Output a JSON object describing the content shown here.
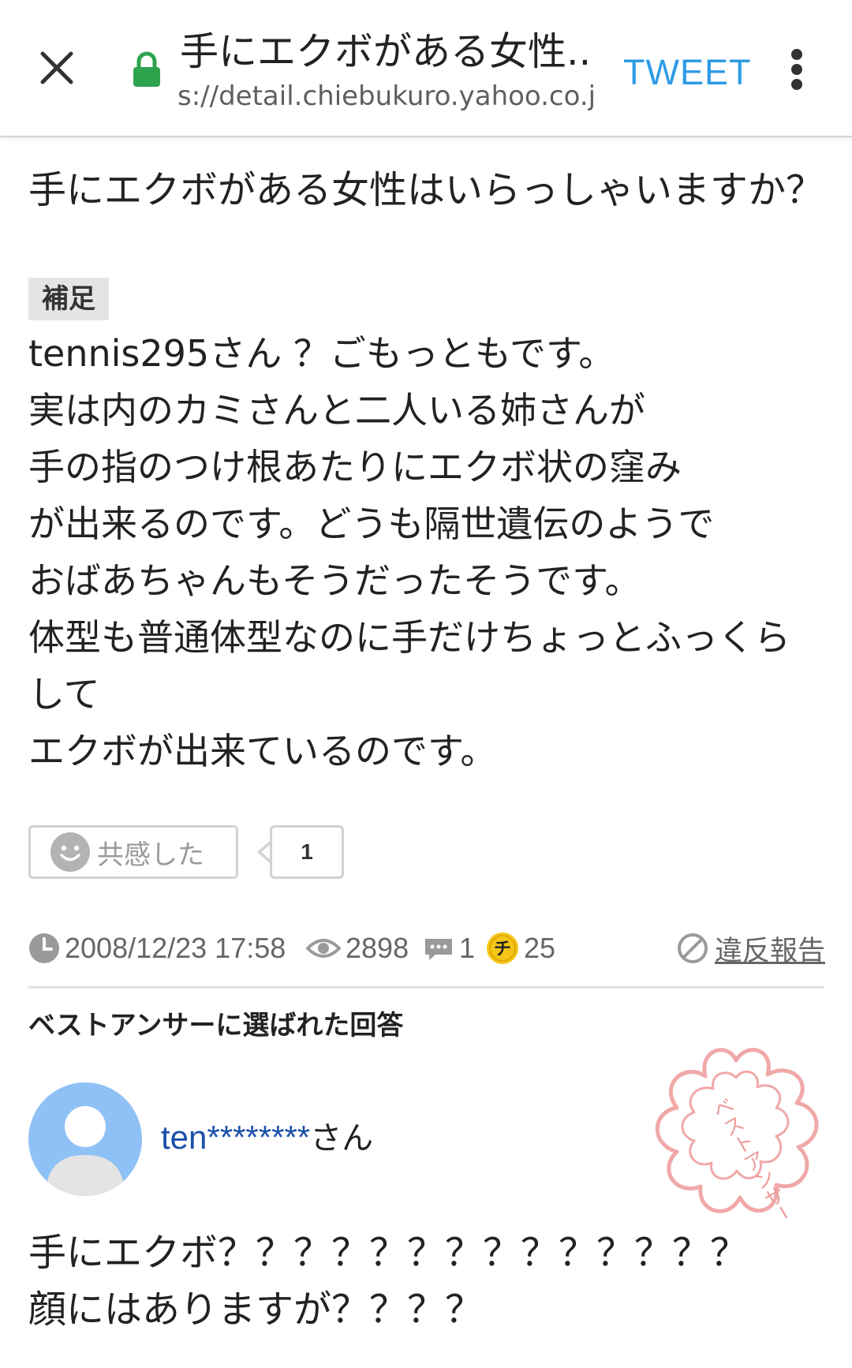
{
  "browser": {
    "title": "手にエクボがある女性...",
    "url": "s://detail.chiebukuro.yahoo.co.jp",
    "tweet_label": "TWEET",
    "close_icon": "close-icon",
    "lock_icon": "lock-icon",
    "menu_icon": "more-vert-icon",
    "colors": {
      "tweet": "#2e9be6",
      "lock": "#2ea44f"
    }
  },
  "question": {
    "title": "手にエクボがある女性はいらっしゃいますか？",
    "supplement_label": "補足",
    "body_lines": [
      "tennis295さん ？ごもっともです。",
      "実は内のカミさんと二人いる姉さんが",
      "手の指のつけ根あたりにエクボ状の窪み",
      "が出来るのです。どうも隔世遺伝のようで",
      "おばあちゃんもそうだったそうです。",
      "体型も普通体型なのに手だけちょっとふっくら",
      "して",
      "エクボが出来ているのです。"
    ],
    "empathy_label": "共感した",
    "empathy_count": "1",
    "smile_icon": "smile-icon"
  },
  "meta": {
    "datetime": "2008/12/23 17:58",
    "views": "2898",
    "answers": "1",
    "coins": "25",
    "coin_glyph": "チ",
    "violation_label": "違反報告",
    "icons": [
      "clock-icon",
      "eye-icon",
      "comment-icon",
      "coin-icon",
      "prohibited-icon"
    ],
    "colors": {
      "coin": "#f5c518"
    }
  },
  "best_answer": {
    "heading": "ベストアンサーに選ばれた回答",
    "user_id": "ten********",
    "user_suffix": "さん",
    "stamp_text": "ベストアンサー",
    "body_lines": [
      "手にエクボ？？？？？？？？？？？？？？",
      "顔にはありますが？？？？"
    ],
    "colors": {
      "user_link": "#1a4fa8",
      "stamp": "#f0a8a8",
      "avatar_bg": "#8ec1f5"
    }
  }
}
